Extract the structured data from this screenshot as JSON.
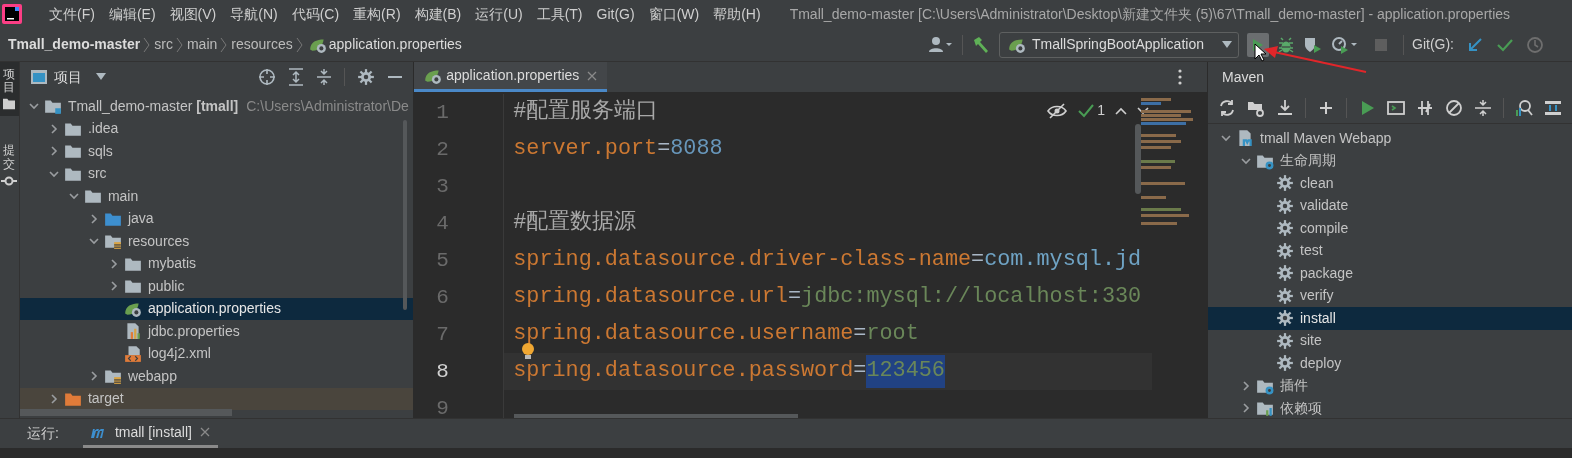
{
  "menu": {
    "items": [
      "文件(F)",
      "编辑(E)",
      "视图(V)",
      "导航(N)",
      "代码(C)",
      "重构(R)",
      "构建(B)",
      "运行(U)",
      "工具(T)",
      "Git(G)",
      "窗口(W)",
      "帮助(H)"
    ]
  },
  "window": {
    "title": "Tmall_demo-master [C:\\Users\\Administrator\\Desktop\\新建文件夹 (5)\\67\\Tmall_demo-master] - application.properties"
  },
  "breadcrumb": [
    {
      "kind": "project",
      "label": "Tmall_demo-master"
    },
    {
      "kind": "dir",
      "label": "src"
    },
    {
      "kind": "dir",
      "label": "main"
    },
    {
      "kind": "dir",
      "label": "resources"
    },
    {
      "kind": "file",
      "label": "application.properties"
    }
  ],
  "toolbar": {
    "run_config": "TmallSpringBootApplication",
    "run_hovered": true,
    "git_label": "Git(G):"
  },
  "side_stripe": [
    {
      "label": "项目",
      "selected": true
    },
    {
      "label": "提交",
      "selected": false
    }
  ],
  "project_panel": {
    "title": "项目",
    "tree": [
      {
        "label": "Tmall_demo-master **[tmall]**",
        "path": "C:\\Users\\Administrator\\De",
        "kind": "module",
        "expanded": true,
        "selected": false,
        "children": [
          {
            "label": ".idea",
            "kind": "folder",
            "expanded": false,
            "selected": false
          },
          {
            "label": "sqls",
            "kind": "folder",
            "expanded": false,
            "selected": false
          },
          {
            "label": "src",
            "kind": "folder",
            "expanded": true,
            "selected": false,
            "children": [
              {
                "label": "main",
                "kind": "folder",
                "expanded": true,
                "selected": false,
                "children": [
                  {
                    "label": "java",
                    "kind": "source_folder",
                    "expanded": false,
                    "selected": false
                  },
                  {
                    "label": "resources",
                    "kind": "resources_folder",
                    "expanded": true,
                    "selected": false,
                    "children": [
                      {
                        "label": "mybatis",
                        "kind": "folder",
                        "expanded": false,
                        "selected": false
                      },
                      {
                        "label": "public",
                        "kind": "folder",
                        "expanded": false,
                        "selected": false
                      },
                      {
                        "label": "application.properties",
                        "kind": "spring_properties",
                        "selected": true
                      },
                      {
                        "label": "jdbc.properties",
                        "kind": "properties",
                        "selected": false
                      },
                      {
                        "label": "log4j2.xml",
                        "kind": "xml",
                        "selected": false
                      }
                    ]
                  },
                  {
                    "label": "webapp",
                    "kind": "resources_folder",
                    "expanded": false,
                    "selected": false
                  }
                ]
              }
            ]
          },
          {
            "label": "target",
            "kind": "excluded_folder",
            "expanded": false,
            "selected": false
          }
        ]
      }
    ]
  },
  "editor": {
    "tab": "application.properties",
    "inspection_count": "1",
    "lines": [
      {
        "number": "1",
        "current": false,
        "segments": [
          {
            "kind": "comment",
            "text": "#配置服务端口",
            "selected": false
          }
        ]
      },
      {
        "number": "2",
        "current": false,
        "segments": [
          {
            "kind": "key",
            "text": "server.port",
            "selected": false
          },
          {
            "kind": "sep",
            "text": "=",
            "selected": false
          },
          {
            "kind": "number",
            "text": "8088",
            "selected": false
          }
        ]
      },
      {
        "number": "3",
        "current": false
      },
      {
        "number": "4",
        "current": false,
        "segments": [
          {
            "kind": "comment",
            "text": "#配置数据源",
            "selected": false
          }
        ]
      },
      {
        "number": "5",
        "current": false,
        "segments": [
          {
            "kind": "key",
            "text": "spring.datasource.driver-class-name",
            "selected": false
          },
          {
            "kind": "sep",
            "text": "=",
            "selected": false
          },
          {
            "kind": "class_ref",
            "text": "com.mysql.jd",
            "selected": false
          }
        ]
      },
      {
        "number": "6",
        "current": false,
        "segments": [
          {
            "kind": "key",
            "text": "spring.datasource.url",
            "selected": false
          },
          {
            "kind": "sep",
            "text": "=",
            "selected": false
          },
          {
            "kind": "value",
            "text": "jdbc:mysql://localhost:330",
            "selected": false
          }
        ]
      },
      {
        "number": "7",
        "current": false,
        "intention_bulb": true,
        "segments": [
          {
            "kind": "key",
            "text": "spring.datasource.username",
            "selected": false
          },
          {
            "kind": "sep",
            "text": "=",
            "selected": false
          },
          {
            "kind": "value",
            "text": "root",
            "selected": false
          }
        ]
      },
      {
        "number": "8",
        "current": true,
        "segments": [
          {
            "kind": "key",
            "text": "spring.datasource.password",
            "selected": false
          },
          {
            "kind": "sep",
            "text": "=",
            "selected": false
          },
          {
            "kind": "value",
            "text": "123456",
            "selected": true
          }
        ]
      },
      {
        "number": "9",
        "current": false
      }
    ]
  },
  "maven_panel": {
    "title": "Maven",
    "tree": [
      {
        "label": "tmall Maven Webapp",
        "kind": "maven_project",
        "expanded": true,
        "selected": false,
        "children": [
          {
            "label": "生命周期",
            "kind": "lifecycle_folder",
            "expanded": true,
            "selected": false,
            "children": [
              {
                "label": "clean",
                "kind": "goal",
                "selected": false
              },
              {
                "label": "validate",
                "kind": "goal",
                "selected": false
              },
              {
                "label": "compile",
                "kind": "goal",
                "selected": false
              },
              {
                "label": "test",
                "kind": "goal",
                "selected": false
              },
              {
                "label": "package",
                "kind": "goal",
                "selected": false
              },
              {
                "label": "verify",
                "kind": "goal",
                "selected": false
              },
              {
                "label": "install",
                "kind": "goal",
                "selected": true
              },
              {
                "label": "site",
                "kind": "goal",
                "selected": false
              },
              {
                "label": "deploy",
                "kind": "goal",
                "selected": false
              }
            ]
          },
          {
            "label": "插件",
            "kind": "lifecycle_folder",
            "expanded": false,
            "selected": false
          },
          {
            "label": "依赖项",
            "kind": "deps_folder",
            "expanded": false,
            "selected": false
          }
        ]
      }
    ]
  },
  "run_bar": {
    "label": "运行:",
    "tab": "tmall [install]"
  }
}
